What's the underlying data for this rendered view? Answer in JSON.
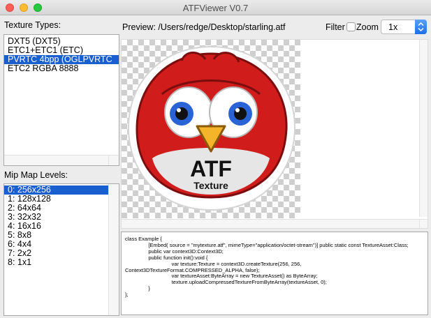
{
  "window": {
    "title": "ATFViewer V0.7"
  },
  "labels": {
    "texture_types": "Texture Types:",
    "mip_levels": "Mip Map Levels:",
    "preview_prefix": "Preview:",
    "preview_path": "/Users/redge/Desktop/starling.atf",
    "filter": "Filter",
    "zoom": "Zoom"
  },
  "zoom_select": {
    "value": "1x"
  },
  "texture_types": [
    {
      "label": "DXT5 (DXT5)"
    },
    {
      "label": "ETC1+ETC1 (ETC)"
    },
    {
      "label": "PVRTC 4bpp (OGLPVRTC"
    },
    {
      "label": "ETC2 RGBA 8888"
    }
  ],
  "texture_selected_index": 2,
  "mip_levels": [
    {
      "label": "0: 256x256"
    },
    {
      "label": "1: 128x128"
    },
    {
      "label": "2: 64x64"
    },
    {
      "label": "3: 32x32"
    },
    {
      "label": "4: 16x16"
    },
    {
      "label": "5: 8x8"
    },
    {
      "label": "6: 4x4"
    },
    {
      "label": "7: 2x2"
    },
    {
      "label": "8: 1x1"
    }
  ],
  "mip_selected_index": 0,
  "badge": {
    "line1": "ATF",
    "line2": "Texture"
  },
  "code_lines": [
    "class Example {",
    "                [Embed( source = \"mytexture.atf\", mimeType=\"application/octet-stream\")] public static const TextureAsset:Class;",
    "                public var context3D:Context3D;",
    "                public function init():void {",
    "                                var texture:Texture = context3D.createTexture(256, 256,",
    "Context3DTextureFormat.COMPRESSED_ALPHA, false);",
    "                                var textureAsset:ByteArray = new TextureAsset() as ByteArray;",
    "                                texture.uploadCompressedTextureFromByteArray(textureAsset, 0);",
    "                }",
    "};"
  ],
  "colors": {
    "selection": "#1a5fcf",
    "bird_red": "#d11c1c",
    "eye_blue": "#2a63d6",
    "beak": "#f5b52b"
  }
}
